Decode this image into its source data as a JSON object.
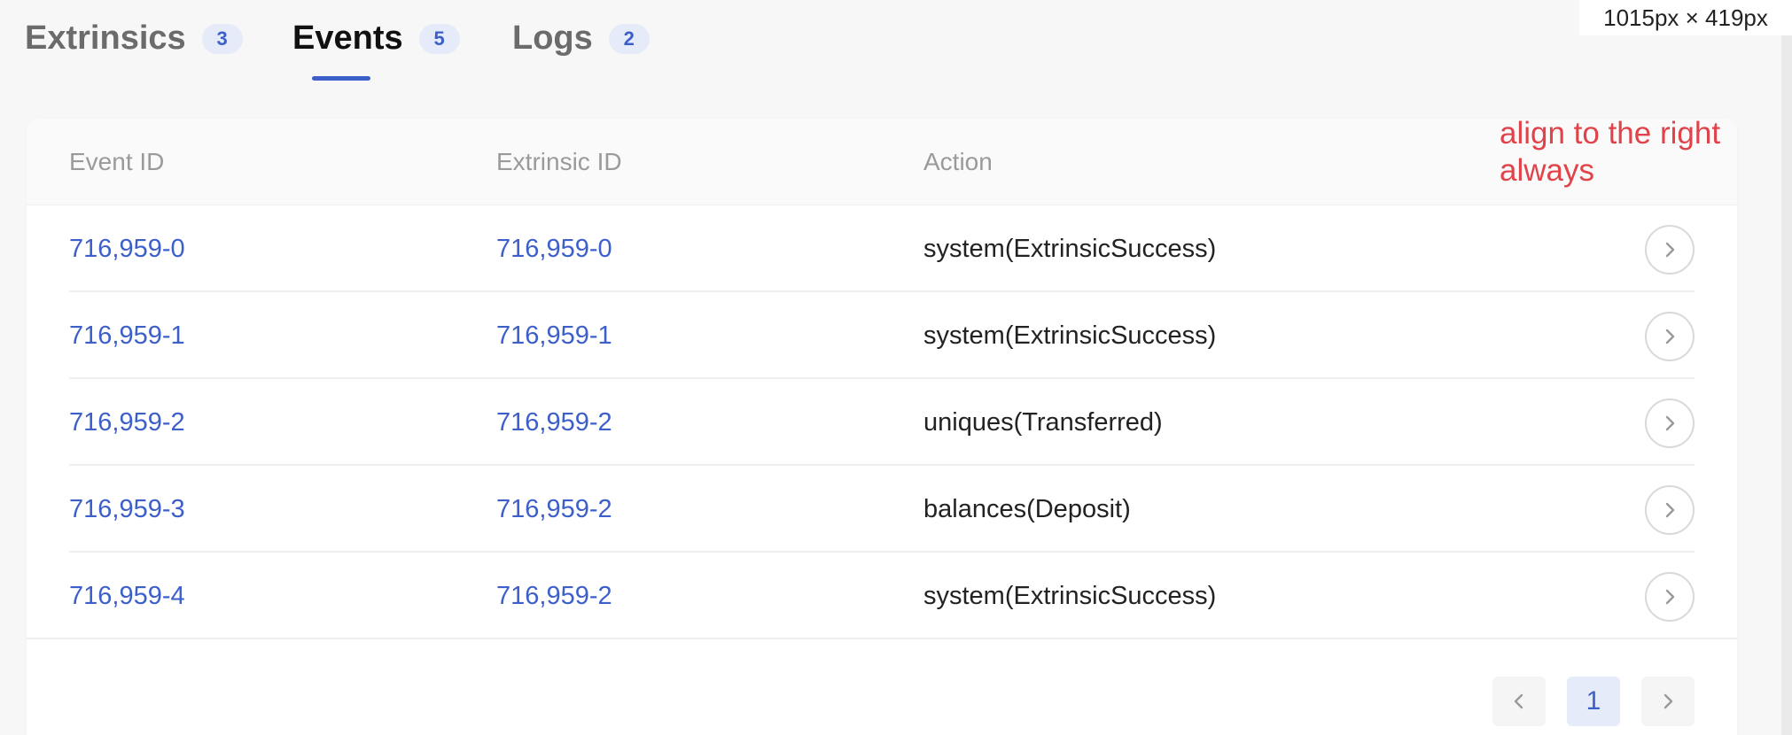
{
  "tabs": [
    {
      "label": "Extrinsics",
      "count": "3"
    },
    {
      "label": "Events",
      "count": "5",
      "active": true
    },
    {
      "label": "Logs",
      "count": "2"
    }
  ],
  "size_tag": "1015px × 419px",
  "table": {
    "headers": [
      "Event ID",
      "Extrinsic ID",
      "Action"
    ],
    "rows": [
      {
        "event_id": "716,959-0",
        "extrinsic_id": "716,959-0",
        "action": "system(ExtrinsicSuccess)"
      },
      {
        "event_id": "716,959-1",
        "extrinsic_id": "716,959-1",
        "action": "system(ExtrinsicSuccess)"
      },
      {
        "event_id": "716,959-2",
        "extrinsic_id": "716,959-2",
        "action": "uniques(Transferred)"
      },
      {
        "event_id": "716,959-3",
        "extrinsic_id": "716,959-2",
        "action": "balances(Deposit)"
      },
      {
        "event_id": "716,959-4",
        "extrinsic_id": "716,959-2",
        "action": "system(ExtrinsicSuccess)"
      }
    ]
  },
  "pagination": {
    "current_page": "1"
  },
  "annotation": "align to the right always",
  "colors": {
    "accent": "#3d5fc9",
    "annotation": "#e0434a"
  },
  "icons": {
    "row_action": "chevron-right-icon",
    "prev": "chevron-left-icon",
    "next": "chevron-right-icon"
  }
}
